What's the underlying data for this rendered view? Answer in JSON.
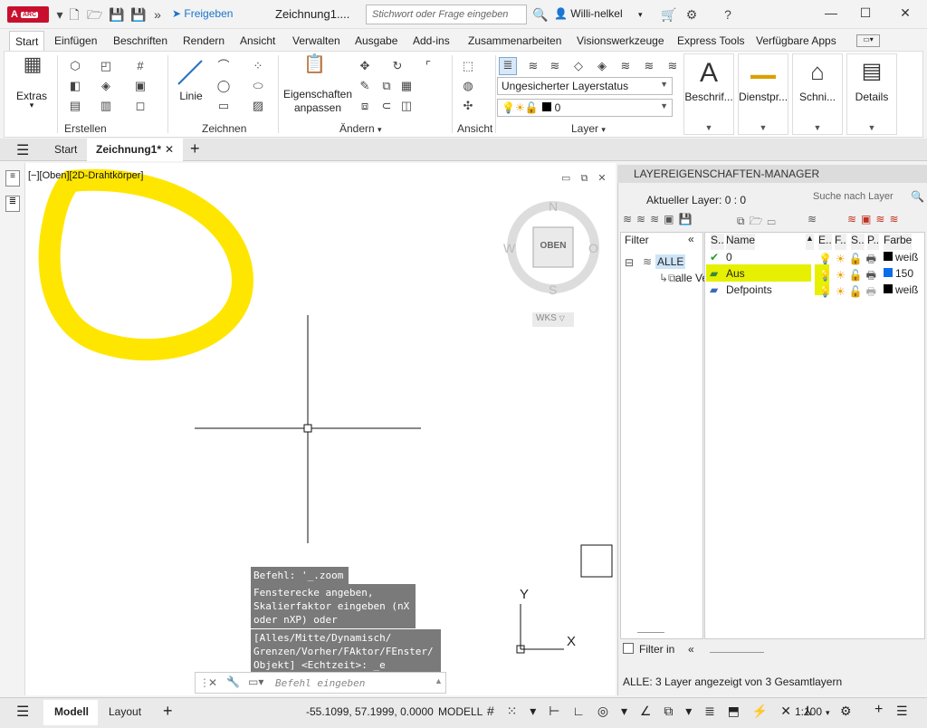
{
  "titlebar": {
    "app_badge": "ARC",
    "share_label": "Freigeben",
    "doc_title": "Zeichnung1....",
    "search_placeholder": "Stichwort oder Frage eingeben",
    "user_name": "Willi-nelkel"
  },
  "ribbon_tabs": [
    "Start",
    "Einfügen",
    "Beschriften",
    "Rendern",
    "Ansicht",
    "Verwalten",
    "Ausgabe",
    "Add-ins",
    "Zusammenarbeiten",
    "Visionswerkzeuge",
    "Express Tools",
    "Verfügbare Apps"
  ],
  "ribbon": {
    "extras_label": "Extras",
    "erstellen_label": "Erstellen",
    "linie_label": "Linie",
    "zeichnen_label": "Zeichnen",
    "eigenschaften_label_1": "Eigenschaften",
    "eigenschaften_label_2": "anpassen",
    "aendern_label": "Ändern",
    "ansicht_label": "Ansicht",
    "layer_label": "Layer",
    "layer_status": "Ungesicherter Layerstatus",
    "layer_current": "0",
    "beschrift_label": "Beschrif...",
    "dienstpr_label": "Dienstpr...",
    "schni_label": "Schni...",
    "details_label": "Details"
  },
  "doc_tabs": {
    "start": "Start",
    "active": "Zeichnung1*"
  },
  "viewport": {
    "view_label": "[−][Oben][2D-Drahtkörper]",
    "compass_n": "N",
    "compass_s": "S",
    "compass_w": "W",
    "compass_o": "O",
    "cube_label": "OBEN",
    "ucs_label": "WKS",
    "axis_y": "Y",
    "axis_x": "X"
  },
  "command": {
    "history_1": "Befehl: '_.zoom",
    "history_2": [
      "Fensterecke angeben,",
      "Skalierfaktor eingeben (nX",
      "oder nXP) oder"
    ],
    "history_3": [
      "[Alles/Mitte/Dynamisch/",
      "Grenzen/Vorher/FAktor/FEnster/",
      "Objekt] <Echtzeit>: _e"
    ],
    "input_placeholder": "Befehl eingeben"
  },
  "layer_manager": {
    "title": "LAYEREIGENSCHAFTEN-MANAGER",
    "current_layer": "Aktueller Layer: 0 : 0",
    "search_placeholder": "Suche nach Layer",
    "filter_header": "Filter",
    "filter_all": "ALLE",
    "filter_all_used": "alle Ve",
    "columns": [
      "S..",
      "Name",
      "E..",
      "F..",
      "S..",
      "P..",
      "Farbe"
    ],
    "layers": [
      {
        "name": "0",
        "color_name": "weiß",
        "color_hex": "#000000"
      },
      {
        "name": "Aus",
        "color_name": "150",
        "color_hex": "#0a6ee8"
      },
      {
        "name": "Defpoints",
        "color_name": "weiß",
        "color_hex": "#000000"
      }
    ],
    "filter_invert": "Filter in",
    "status": "ALLE: 3 Layer angezeigt von 3 Gesamtlayern"
  },
  "statusbar": {
    "modell_tab": "Modell",
    "layout_tab": "Layout",
    "coordinates": "-55.1099, 57.1999, 0.0000",
    "modell_btn": "MODELL",
    "scale": "1:100"
  },
  "colors": {
    "highlight": "#e6f000",
    "accent": "#1a73c9",
    "annotation": "#ffe600"
  }
}
